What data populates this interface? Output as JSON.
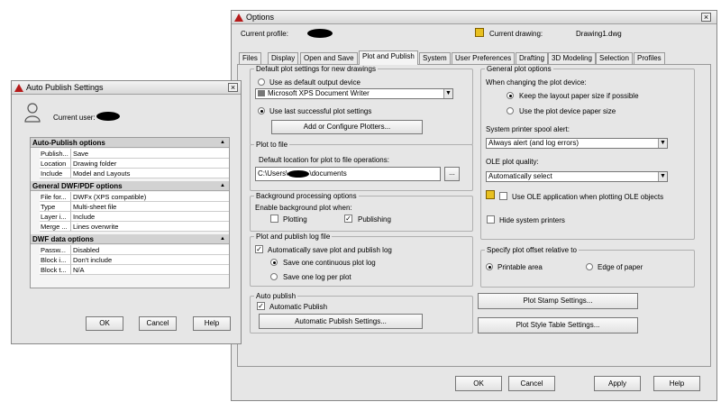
{
  "options": {
    "title": "Options",
    "current_profile_label": "Current profile:",
    "current_drawing_label": "Current drawing:",
    "current_drawing_value": "Drawing1.dwg",
    "tabs": [
      "Files",
      "Display",
      "Open and Save",
      "Plot and Publish",
      "System",
      "User Preferences",
      "Drafting",
      "3D Modeling",
      "Selection",
      "Profiles"
    ],
    "default_plot": {
      "group_label": "Default plot settings for new drawings",
      "use_default_output": "Use as default output device",
      "device_value": "Microsoft XPS Document Writer",
      "use_last_successful": "Use last successful plot settings",
      "add_plotters_btn": "Add or Configure Plotters..."
    },
    "plot_to_file": {
      "group_label": "Plot to file",
      "location_label": "Default location for plot to file operations:",
      "path_prefix": "C:\\Users\\",
      "path_suffix": "\\documents",
      "browse_btn": "..."
    },
    "background": {
      "group_label": "Background processing options",
      "enable_label": "Enable background plot when:",
      "plotting": "Plotting",
      "publishing": "Publishing"
    },
    "log": {
      "group_label": "Plot and publish log file",
      "auto_save": "Automatically save plot and publish log",
      "one_continuous": "Save one continuous plot log",
      "one_per_plot": "Save one log per plot"
    },
    "auto_publish": {
      "group_label": "Auto publish",
      "automatic": "Automatic Publish",
      "settings_btn": "Automatic Publish Settings..."
    },
    "general": {
      "group_label": "General plot options",
      "changing_label": "When changing the plot device:",
      "keep_layout": "Keep the layout paper size if possible",
      "use_device": "Use the plot device paper size",
      "spool_label": "System printer spool alert:",
      "spool_value": "Always alert (and log errors)",
      "ole_label": "OLE plot quality:",
      "ole_value": "Automatically select",
      "use_ole": "Use OLE application when plotting OLE objects",
      "hide_printers": "Hide system printers"
    },
    "offset": {
      "group_label": "Specify plot offset relative to",
      "printable": "Printable area",
      "edge": "Edge of paper"
    },
    "stamp_btn": "Plot Stamp Settings...",
    "style_btn": "Plot Style Table Settings...",
    "ok": "OK",
    "cancel": "Cancel",
    "apply": "Apply",
    "help": "Help"
  },
  "aps": {
    "title": "Auto Publish Settings",
    "current_user_label": "Current user:",
    "sections": [
      {
        "name": "Auto-Publish options",
        "rows": [
          [
            "Publish...",
            "Save"
          ],
          [
            "Location",
            "Drawing folder"
          ],
          [
            "Include",
            "Model and Layouts"
          ]
        ]
      },
      {
        "name": "General DWF/PDF options",
        "rows": [
          [
            "File for...",
            "DWFx (XPS compatible)"
          ],
          [
            "Type",
            "Multi-sheet file"
          ],
          [
            "Layer i...",
            "Include"
          ],
          [
            "Merge ...",
            "Lines overwrite"
          ]
        ]
      },
      {
        "name": "DWF data options",
        "rows": [
          [
            "Passw...",
            "Disabled"
          ],
          [
            "Block i...",
            "Don't include"
          ],
          [
            "Block t...",
            "N/A"
          ]
        ]
      }
    ],
    "ok": "OK",
    "cancel": "Cancel",
    "help": "Help"
  },
  "colors": {
    "accent": "#b61a1a",
    "window_bg": "#e6e6e6"
  }
}
